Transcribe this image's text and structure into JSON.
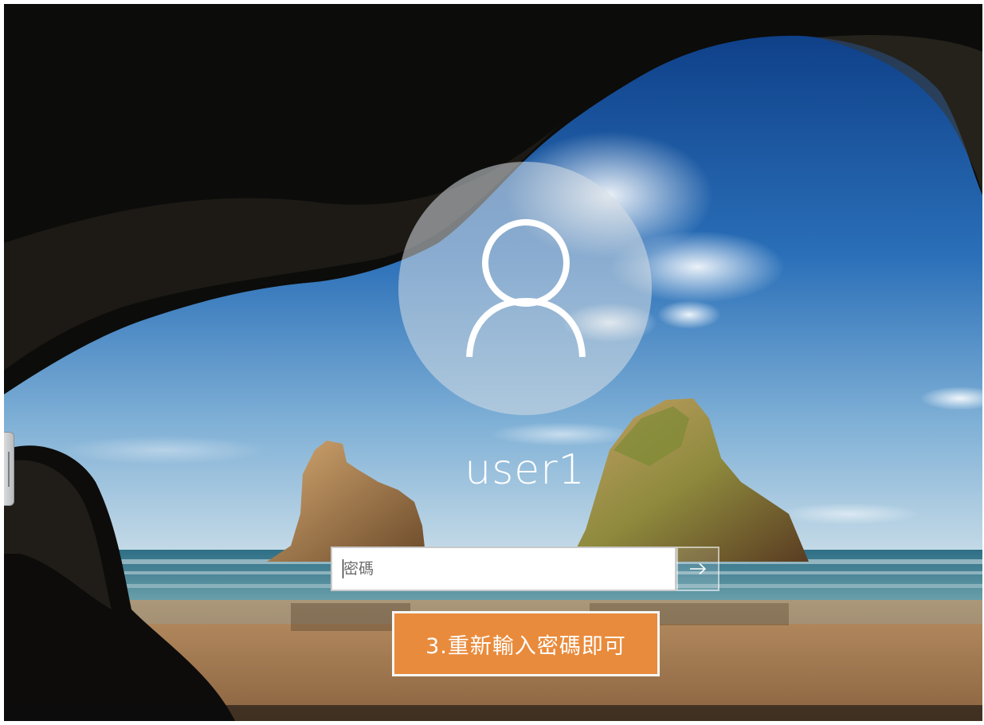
{
  "login": {
    "username": "user1",
    "password_placeholder": "密碼",
    "password_value": ""
  },
  "annotation": {
    "text": "3.重新輸入密碼即可"
  },
  "icons": {
    "avatar": "user-silhouette-icon",
    "submit": "arrow-right-icon"
  },
  "colors": {
    "callout_fill": "#e98b3c",
    "callout_border": "#f6f6f6",
    "avatar_circle": "#d7dee4"
  }
}
